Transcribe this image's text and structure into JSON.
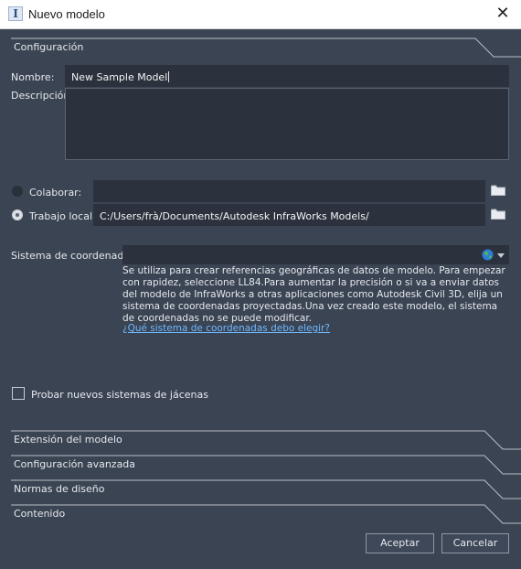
{
  "window": {
    "title": "Nuevo modelo",
    "close_glyph": "✕",
    "app_icon_glyph": "I"
  },
  "sections": {
    "config": "Configuración",
    "extent": "Extensión del modelo",
    "advanced": "Configuración avanzada",
    "design": "Normas de diseño",
    "content": "Contenido"
  },
  "form": {
    "name_label": "Nombre:",
    "name_value": "New Sample Model",
    "description_label": "Descripción:",
    "description_value": "",
    "collaborate_label": "Colaborar:",
    "collaborate_value": "",
    "collaborate_selected": false,
    "local_label": "Trabajo local:",
    "local_value": "C:/Users/frà/Documents/Autodesk InfraWorks Models/",
    "local_selected": true,
    "coord_label": "Sistema de coordenadas:",
    "coord_value": "",
    "coord_help": "Se utiliza para crear referencias geográficas de datos de modelo. Para empezar con rapidez, seleccione LL84.Para aumentar la precisión o si va a enviar datos del modelo de InfraWorks a otras aplicaciones como Autodesk Civil 3D, elija un sistema de coordenadas proyectadas.Una vez creado este modelo, el sistema de coordenadas no se puede modificar.",
    "coord_help_link": "¿Qué sistema de coordenadas debo elegir?",
    "checkbox_label": "Probar nuevos sistemas de jácenas",
    "checkbox_checked": false
  },
  "buttons": {
    "accept": "Aceptar",
    "cancel": "Cancelar"
  },
  "colors": {
    "background": "#3b4453",
    "field": "#2b323d",
    "link": "#6fb9ff",
    "section_line": "#b9bec6"
  }
}
